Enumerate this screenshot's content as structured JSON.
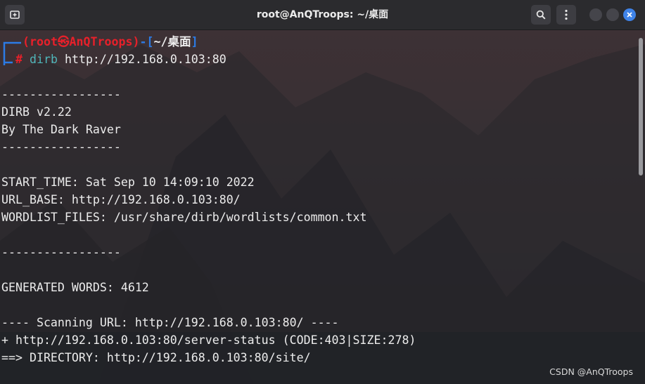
{
  "window": {
    "title": "root@AnQTroops: ~/桌面"
  },
  "prompt": {
    "user_host": "(root㉿AnQTroops)",
    "open_bracket": "[",
    "path": "~/桌面",
    "close_bracket": "]",
    "symbol": "#",
    "command": "dirb",
    "argument": "http://192.168.0.103:80"
  },
  "output": {
    "rule1": "-----------------",
    "version": "DIRB v2.22",
    "author": "By The Dark Raver",
    "rule2": "-----------------",
    "start_time": "START_TIME: Sat Sep 10 14:09:10 2022",
    "url_base": "URL_BASE: http://192.168.0.103:80/",
    "wordlist": "WORDLIST_FILES: /usr/share/dirb/wordlists/common.txt",
    "rule3": "-----------------",
    "generated": "GENERATED WORDS: 4612",
    "scanning": "---- Scanning URL: http://192.168.0.103:80/ ----",
    "found1": "+ http://192.168.0.103:80/server-status (CODE:403|SIZE:278)",
    "found2": "==> DIRECTORY: http://192.168.0.103:80/site/"
  },
  "watermark": "CSDN @AnQTroops",
  "colors": {
    "prompt_user": "#e8202a",
    "prompt_bracket": "#2c7be5",
    "command": "#4fb6ba",
    "close_button": "#3f83e8"
  },
  "icons": {
    "new_tab": "new-tab-icon",
    "search": "search-icon",
    "menu": "kebab-menu-icon",
    "close": "close-icon"
  }
}
